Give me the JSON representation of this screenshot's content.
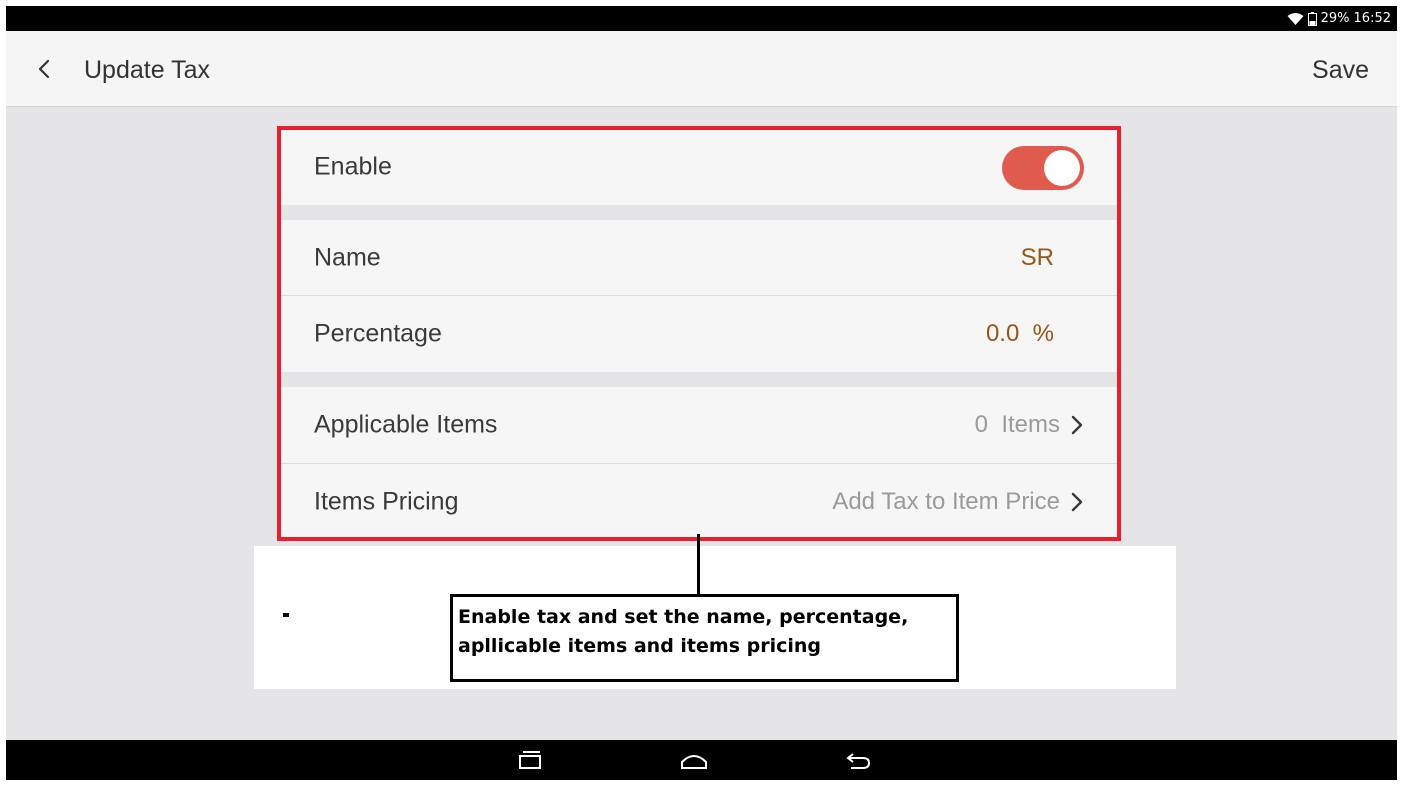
{
  "status_bar": {
    "battery": "29%",
    "time": "16:52"
  },
  "app_bar": {
    "title": "Update Tax",
    "save_label": "Save"
  },
  "settings": {
    "enable": {
      "label": "Enable",
      "enabled": true
    },
    "name": {
      "label": "Name",
      "value": "SR"
    },
    "percentage": {
      "label": "Percentage",
      "value": "0.0  %"
    },
    "applicable_items": {
      "label": "Applicable Items",
      "value": "0  Items"
    },
    "items_pricing": {
      "label": "Items Pricing",
      "value": "Add Tax to Item Price"
    }
  },
  "callout": {
    "line1": "Enable tax and set the name, percentage,",
    "line2": "apllicable items and items pricing"
  },
  "colors": {
    "accent": "#9a5515",
    "toggle_on": "#e15a4e",
    "highlight": "#e8202e"
  },
  "icons": {
    "back": "chevron-left-icon",
    "row_chevron": "chevron-right-icon",
    "nav_recent": "recent-apps-icon",
    "nav_home": "home-icon",
    "nav_back": "back-arrow-icon"
  }
}
